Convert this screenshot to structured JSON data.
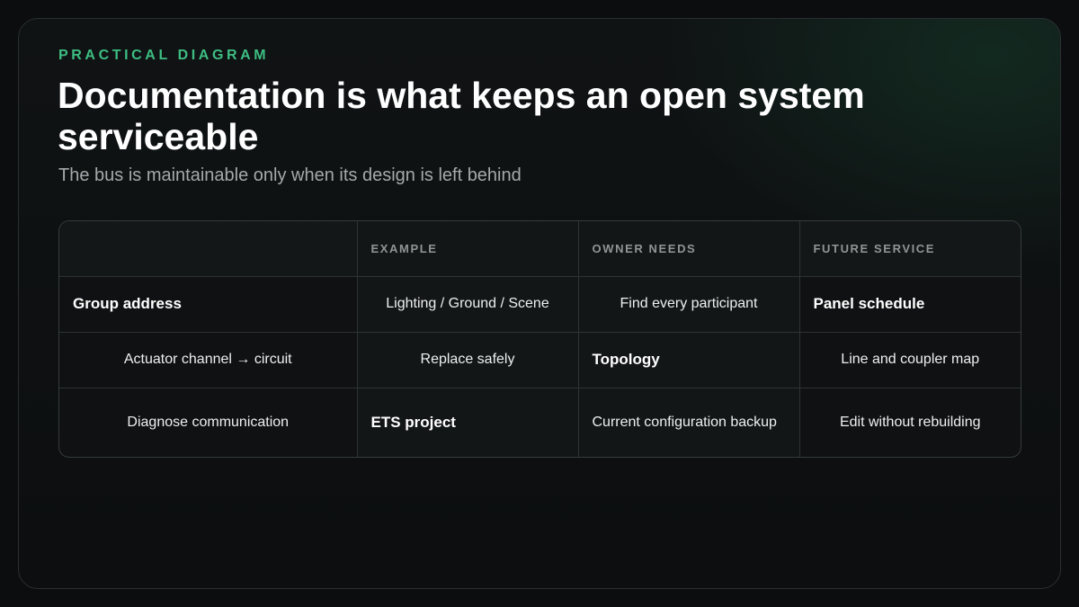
{
  "eyebrow": "PRACTICAL DIAGRAM",
  "title": "Documentation is what keeps an open system serviceable",
  "subtitle": "The bus is maintainable only when its design is left behind",
  "table": {
    "headers": [
      "",
      "EXAMPLE",
      "OWNER NEEDS",
      "FUTURE SERVICE"
    ],
    "rows": [
      [
        "Group address",
        "Lighting / Ground / Scene",
        "Find every participant",
        "Panel schedule"
      ],
      [
        "Actuator channel → circuit",
        "Replace safely",
        "Topology",
        "Line and coupler map"
      ],
      [
        "Diagnose communication",
        "ETS project",
        "Current configuration backup",
        "Edit without rebuilding"
      ]
    ]
  }
}
